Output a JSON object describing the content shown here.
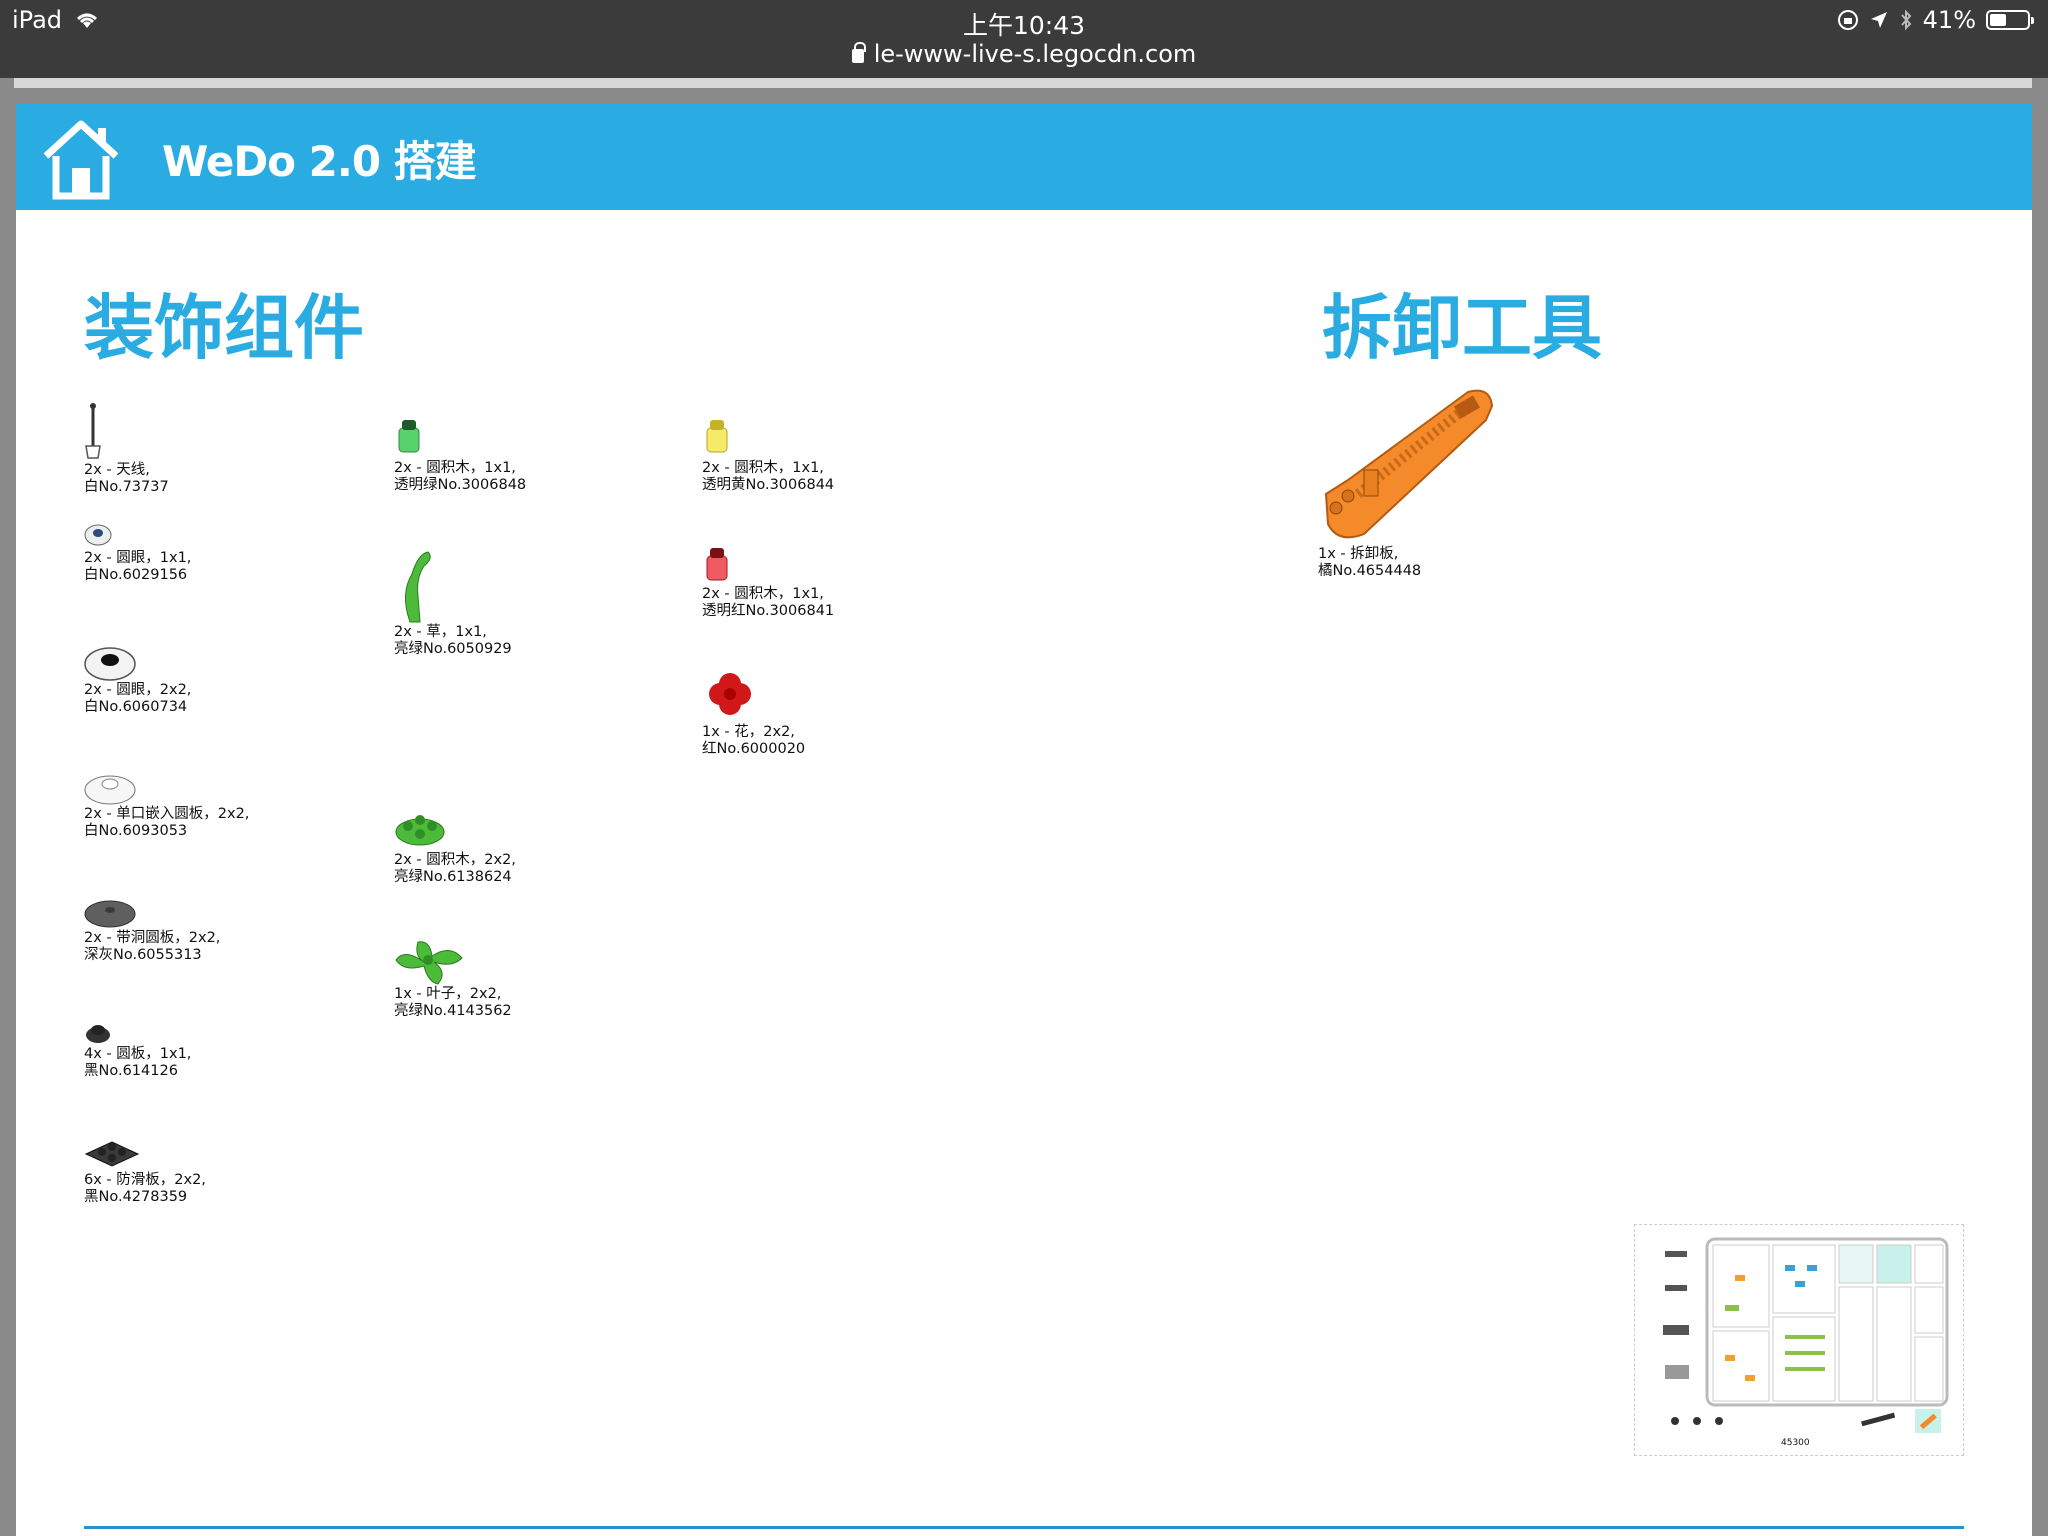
{
  "status_bar": {
    "device": "iPad",
    "time": "上午10:43",
    "url": "le-www-live-s.legocdn.com",
    "battery": "41%",
    "battery_level": 0.41
  },
  "header": {
    "title": "WeDo 2.0 搭建",
    "home_icon": "home-icon"
  },
  "sections": {
    "decor_title": "装饰组件",
    "tool_title": "拆卸工具"
  },
  "parts_col1": [
    {
      "l1": "2x - 天线,",
      "l2": "白No.73737",
      "icon": "antenna",
      "color": "#ffffff"
    },
    {
      "l1": "2x - 圆眼，1x1,",
      "l2": "白No.6029156",
      "icon": "eye-small",
      "color": "#ffffff"
    },
    {
      "l1": "2x - 圆眼，2x2,",
      "l2": "白No.6060734",
      "icon": "eye-large",
      "color": "#ffffff"
    },
    {
      "l1": "2x - 单口嵌入圆板，2x2,",
      "l2": "白No.6093053",
      "icon": "round-plate-white",
      "color": "#ffffff"
    },
    {
      "l1": "2x - 带洞圆板，2x2,",
      "l2": "深灰No.6055313",
      "icon": "round-plate-grey",
      "color": "#6b6b6b"
    },
    {
      "l1": "4x - 圆板，1x1,",
      "l2": "黑No.614126",
      "icon": "round-plate-black",
      "color": "#2a2a2a"
    },
    {
      "l1": "6x - 防滑板，2x2,",
      "l2": "黑No.4278359",
      "icon": "antislip-plate",
      "color": "#2a2a2a"
    }
  ],
  "parts_col2": [
    {
      "l1": "2x - 圆积木，1x1,",
      "l2": "透明绿No.3006848",
      "icon": "round-brick-green",
      "color": "#3fcc5a"
    },
    {
      "l1": "2x - 草，1x1,",
      "l2": "亮绿No.6050929",
      "icon": "grass",
      "color": "#4cbb3a"
    },
    {
      "l1": "2x - 圆积木，2x2,",
      "l2": "亮绿No.6138624",
      "icon": "round-brick-2x2",
      "color": "#4cbb3a"
    },
    {
      "l1": "1x - 叶子，2x2,",
      "l2": "亮绿No.4143562",
      "icon": "leaf",
      "color": "#4cbb3a"
    }
  ],
  "parts_col3": [
    {
      "l1": "2x - 圆积木，1x1,",
      "l2": "透明黄No.3006844",
      "icon": "round-brick-yellow",
      "color": "#f3e24a"
    },
    {
      "l1": "2x - 圆积木，1x1,",
      "l2": "透明红No.3006841",
      "icon": "round-brick-red",
      "color": "#e83a40"
    },
    {
      "l1": "1x - 花，2x2,",
      "l2": "红No.6000020",
      "icon": "flower",
      "color": "#d11818"
    }
  ],
  "tool": {
    "l1": "1x - 拆卸板,",
    "l2": "橘No.4654448",
    "icon": "brick-separator",
    "color": "#f58a2a"
  },
  "overview": {
    "set_number": "45300"
  }
}
